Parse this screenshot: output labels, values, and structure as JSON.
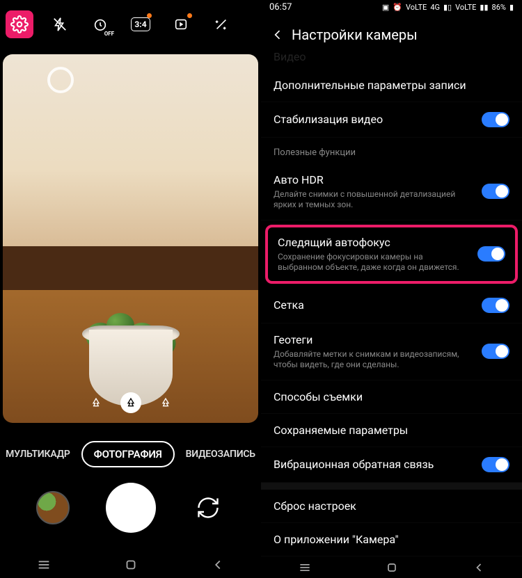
{
  "left": {
    "topIcons": {
      "settings": "settings",
      "flash": "flash-off",
      "timer": "off-timer",
      "timer_label": "OFF",
      "ratio": "3:4",
      "motion": "motion-photo",
      "filters": "filters"
    },
    "zoom": {
      "wide": "tree-wide",
      "normal": "tree",
      "tele": "tree-tele"
    },
    "modes": {
      "prev": "МУЛЬТИКАДР",
      "current": "ФОТОГРАФИЯ",
      "next": "ВИДЕОЗАПИСЬ"
    },
    "nav": {
      "recents": "recents",
      "home": "home",
      "back": "back"
    }
  },
  "right": {
    "status": {
      "time": "06:57",
      "battery": "86%",
      "lte": "4G",
      "vol": "VoLTE"
    },
    "header": "Настройки камеры",
    "truncated_label": "Видео",
    "section_useful": "Полезные функции",
    "items": {
      "adv_record": {
        "title": "Дополнительные параметры записи"
      },
      "stabilize": {
        "title": "Стабилизация видео"
      },
      "autohdr": {
        "title": "Авто HDR",
        "sub": "Делайте снимки с повышенной детализацией ярких и темных зон."
      },
      "trackaf": {
        "title": "Следящий автофокус",
        "sub": "Сохранение фокусировки камеры на выбранном объекте, даже когда он движется."
      },
      "grid": {
        "title": "Сетка"
      },
      "geotag": {
        "title": "Геотеги",
        "sub": "Добавляйте метки к снимкам и видеозаписям, чтобы видеть, где они сделаны."
      },
      "shooting": {
        "title": "Способы съемки"
      },
      "savepref": {
        "title": "Сохраняемые параметры"
      },
      "haptic": {
        "title": "Вибрационная обратная связь"
      },
      "reset": {
        "title": "Сброс настроек"
      },
      "about": {
        "title": "О приложении \"Камера\""
      }
    }
  }
}
